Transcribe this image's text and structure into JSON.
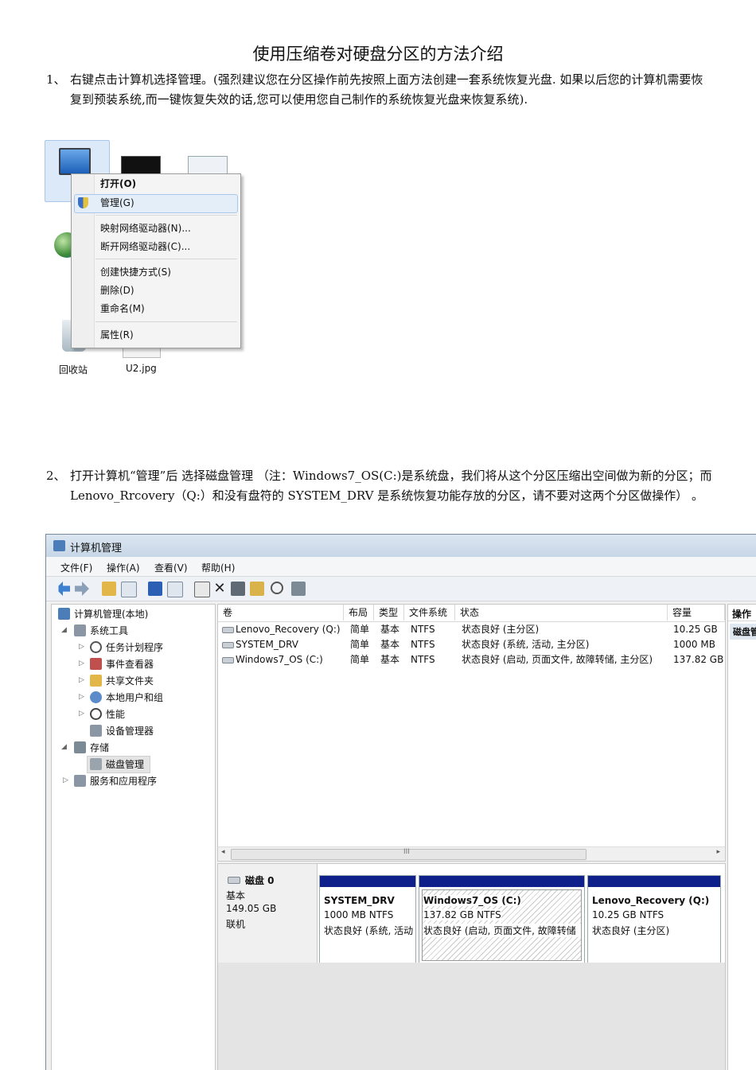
{
  "doc": {
    "title": "使用压缩卷对硬盘分区的方法介绍",
    "step1": {
      "num": "1、",
      "text": "右键点击计算机选择管理。(强烈建议您在分区操作前先按照上面方法创建一套系统恢复光盘. 如果以后您的计算机需要恢复到预装系统,而一键恢复失效的话,您可以使用您自己制作的系统恢复光盘来恢复系统)."
    },
    "step2": {
      "num": "2、",
      "text": "打开计算机“管理”后 选择磁盘管理 （注：Windows7_OS(C:)是系统盘，我们将从这个分区压缩出空间做为新的分区；而 Lenovo_Rrcovery（Q:）和没有盘符的 SYSTEM_DRV 是系统恢复功能存放的分区，请不要对这两个分区做操作） 。"
    }
  },
  "screenshot1": {
    "context_menu": {
      "items": [
        "打开(O)",
        "管理(G)",
        "映射网络驱动器(N)...",
        "断开网络驱动器(C)...",
        "创建快捷方式(S)",
        "删除(D)",
        "重命名(M)",
        "属性(R)"
      ]
    },
    "icon_labels": {
      "recycle": "回收站",
      "jpg": "U2.jpg"
    }
  },
  "screenshot2": {
    "window_title": "计算机管理",
    "menu": [
      "文件(F)",
      "操作(A)",
      "查看(V)",
      "帮助(H)"
    ],
    "tree": [
      {
        "label": "计算机管理(本地)"
      },
      {
        "label": "系统工具"
      },
      {
        "label": "任务计划程序"
      },
      {
        "label": "事件查看器"
      },
      {
        "label": "共享文件夹"
      },
      {
        "label": "本地用户和组"
      },
      {
        "label": "性能"
      },
      {
        "label": "设备管理器"
      },
      {
        "label": "存储"
      },
      {
        "label": "磁盘管理"
      },
      {
        "label": "服务和应用程序"
      }
    ],
    "columns": [
      "卷",
      "布局",
      "类型",
      "文件系统",
      "状态",
      "容量"
    ],
    "rows": [
      [
        "Lenovo_Recovery (Q:)",
        "简单",
        "基本",
        "NTFS",
        "状态良好 (主分区)",
        "10.25 GB"
      ],
      [
        "SYSTEM_DRV",
        "简单",
        "基本",
        "NTFS",
        "状态良好 (系统, 活动, 主分区)",
        "1000 MB"
      ],
      [
        "Windows7_OS (C:)",
        "简单",
        "基本",
        "NTFS",
        "状态良好 (启动, 页面文件, 故障转储, 主分区)",
        "137.82 GB"
      ]
    ],
    "scroll_mark": "III",
    "actions_header": "操作",
    "actions_item": "磁盘管",
    "disk": {
      "name": "磁盘 0",
      "type": "基本",
      "size": "149.05 GB",
      "status": "联机"
    },
    "partitions": [
      {
        "name": "SYSTEM_DRV",
        "size": "1000 MB NTFS",
        "status": "状态良好 (系统, 活动"
      },
      {
        "name": "Windows7_OS  (C:)",
        "size": "137.82 GB NTFS",
        "status": "状态良好 (启动, 页面文件, 故障转储"
      },
      {
        "name": "Lenovo_Recovery  (Q:)",
        "size": "10.25 GB NTFS",
        "status": "状态良好 (主分区)"
      }
    ]
  }
}
